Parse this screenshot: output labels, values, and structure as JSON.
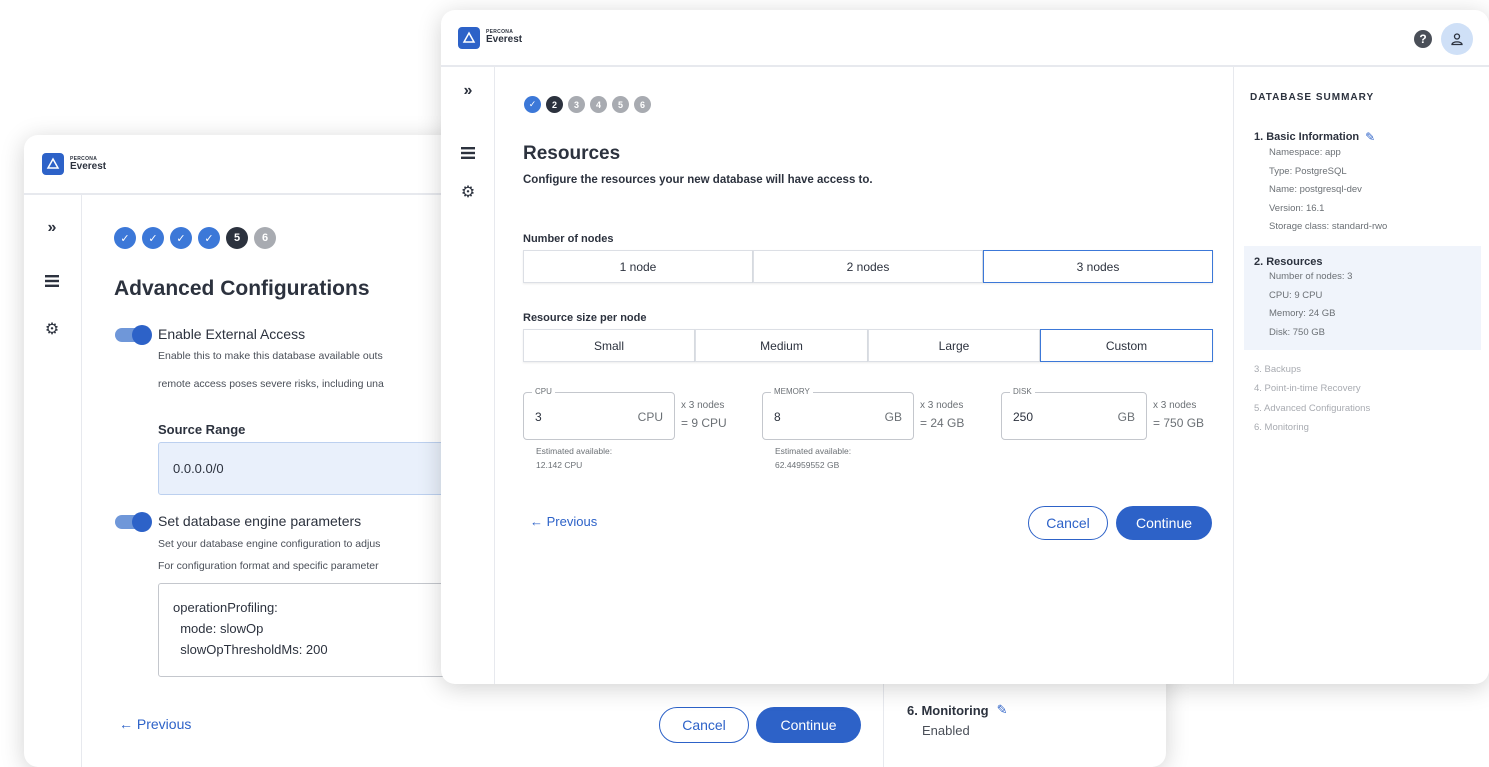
{
  "brand": {
    "top": "PERCONA",
    "bottom": "Everest"
  },
  "back": {
    "steps": [
      "✓",
      "✓",
      "✓",
      "✓",
      "5",
      "6"
    ],
    "title": "Advanced Configurations",
    "external_access": {
      "label": "Enable External Access",
      "desc1": "Enable this to make this database available outs",
      "desc2": "remote access poses severe risks, including una"
    },
    "source_range": {
      "label": "Source Range",
      "value": "0.0.0.0/0"
    },
    "engine_params": {
      "label": "Set database engine parameters",
      "desc1": "Set your database engine configuration to adjus",
      "desc2": "For configuration format and specific parameter",
      "code_lines": [
        "operationProfiling:",
        "  mode: slowOp",
        "  slowOpThresholdMs: 200"
      ]
    },
    "previous": "← Previous",
    "cancel": "Cancel",
    "continue": "Continue",
    "monitoring": {
      "title": "6. Monitoring",
      "value": "Enabled"
    }
  },
  "front": {
    "steps": [
      "✓",
      "2",
      "3",
      "4",
      "5",
      "6"
    ],
    "title": "Resources",
    "subtitle": "Configure the resources your new database will have access to.",
    "nodes": {
      "label": "Number of nodes",
      "options": [
        "1 node",
        "2 nodes",
        "3 nodes"
      ],
      "selected": "3 nodes"
    },
    "size": {
      "label": "Resource size per node",
      "options": [
        "Small",
        "Medium",
        "Large",
        "Custom"
      ],
      "selected": "Custom"
    },
    "cpu": {
      "label": "CPU",
      "value": "3",
      "unit": "CPU",
      "mult1": "x 3 nodes",
      "mult2": "= 9 CPU",
      "est1": "Estimated available:",
      "est2": "12.142 CPU"
    },
    "memory": {
      "label": "MEMORY",
      "value": "8",
      "unit": "GB",
      "mult1": "x 3 nodes",
      "mult2": "= 24 GB",
      "est1": "Estimated available:",
      "est2": "62.44959552 GB"
    },
    "disk": {
      "label": "DISK",
      "value": "250",
      "unit": "GB",
      "mult1": "x 3 nodes",
      "mult2": "= 750 GB"
    },
    "previous": "← Previous",
    "cancel": "Cancel",
    "continue": "Continue"
  },
  "summary": {
    "title": "DATABASE SUMMARY",
    "basic": {
      "heading": "1. Basic Information",
      "lines": [
        "Namespace: app",
        "Type: PostgreSQL",
        "Name: postgresql-dev",
        "Version: 16.1",
        "Storage class: standard-rwo"
      ]
    },
    "resources": {
      "heading": "2. Resources",
      "lines": [
        "Number of nodes: 3",
        "CPU: 9 CPU",
        "Memory: 24 GB",
        "Disk: 750 GB"
      ]
    },
    "pending": [
      "3. Backups",
      "4. Point-in-time Recovery",
      "5. Advanced Configurations",
      "6. Monitoring"
    ]
  },
  "colors": {
    "accent": "#2d62c8",
    "step_done": "#3c78d8",
    "step_current": "#2c323e",
    "step_todo": "#a8abb1"
  },
  "icons": [
    "logo-icon",
    "expand-icon",
    "list-icon",
    "gear-icon",
    "help-icon",
    "user-icon",
    "edit-icon",
    "check-icon"
  ]
}
